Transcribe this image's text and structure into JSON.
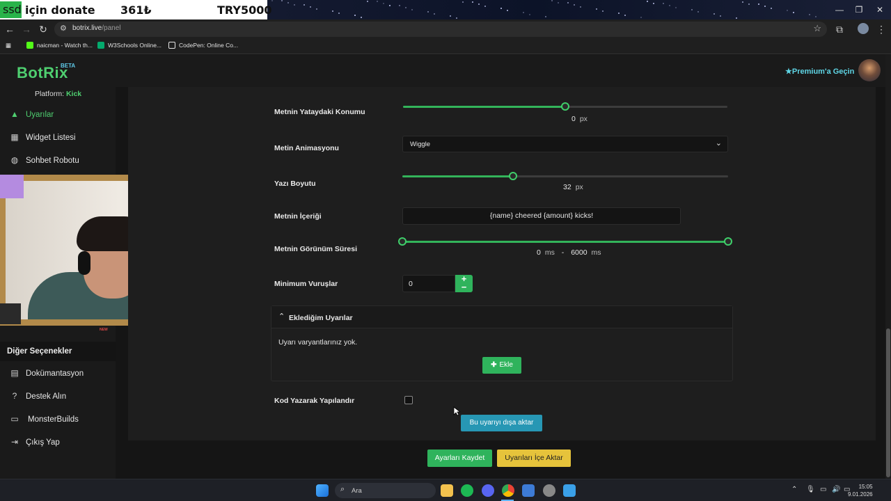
{
  "stream_banner": {
    "badge": "ssd",
    "text": "için donate",
    "amount": "361₺",
    "goal": "TRY5000"
  },
  "browser": {
    "url_host": "botrix.live",
    "url_path": "/panel",
    "bookmarks": [
      {
        "label": "naicman - Watch th...",
        "icon_color": "#53fc18"
      },
      {
        "label": "W3Schools Online...",
        "icon_color": "#04aa6d"
      },
      {
        "label": "CodePen: Online Co...",
        "icon_color": "#e6e6e6"
      }
    ]
  },
  "app": {
    "logo": "BotRix",
    "beta": "BETA",
    "premium_label": "Premium'a Geçin",
    "platform_label": "Platform:",
    "platform_value": "Kick"
  },
  "sidebar": {
    "items_top": [
      {
        "label": "Uyarılar",
        "icon": "warning-icon",
        "active": true
      },
      {
        "label": "Widget Listesi",
        "icon": "grid-icon",
        "active": false
      },
      {
        "label": "Sohbet Robotu",
        "icon": "robot-icon",
        "active": false
      }
    ],
    "section_title": "Diğer Seçenekler",
    "items_bottom": [
      {
        "label": "Dokümantasyon",
        "icon": "scroll-icon"
      },
      {
        "label": "Destek Alın",
        "icon": "question-icon"
      },
      {
        "label": "MonsterBuilds",
        "icon": "laptop-icon"
      },
      {
        "label": "Çıkış Yap",
        "icon": "logout-icon"
      }
    ],
    "new_badge": "NEW"
  },
  "form": {
    "horizontal_label": "Metnin Yataydaki Konumu",
    "horizontal_value": "0",
    "horizontal_unit": "px",
    "horizontal_fraction": 0.5,
    "animation_label": "Metin Animasyonu",
    "animation_value": "Wiggle",
    "font_size_label": "Yazı Boyutu",
    "font_size_value": "32",
    "font_size_unit": "px",
    "font_size_fraction": 0.34,
    "content_label": "Metnin İçeriği",
    "content_value": "{name} cheered {amount} kicks!",
    "duration_label": "Metnin Görünüm Süresi",
    "duration_min": "0",
    "duration_max": "6000",
    "duration_unit": "ms",
    "duration_sep": "-",
    "min_hits_label": "Minimum Vuruşlar",
    "min_hits_value": "0",
    "stepper_up": "+",
    "stepper_down": "−",
    "variants_title": "Eklediğim Uyarılar",
    "variants_empty": "Uyarı varyantlarınız yok.",
    "add_label": "Ekle",
    "code_config_label": "Kod Yazarak Yapılandır",
    "export_label": "Bu uyarıyı dışa aktar",
    "save_label": "Ayarları Kaydet",
    "import_label": "Uyarıları İçe Aktar"
  },
  "taskbar": {
    "search_placeholder": "Ara",
    "time": "15:05",
    "date": "9.01.2026"
  },
  "colors": {
    "accent": "#33b45a",
    "export": "#2797b4",
    "import": "#e6c33b",
    "premium": "#5fd6e6"
  }
}
